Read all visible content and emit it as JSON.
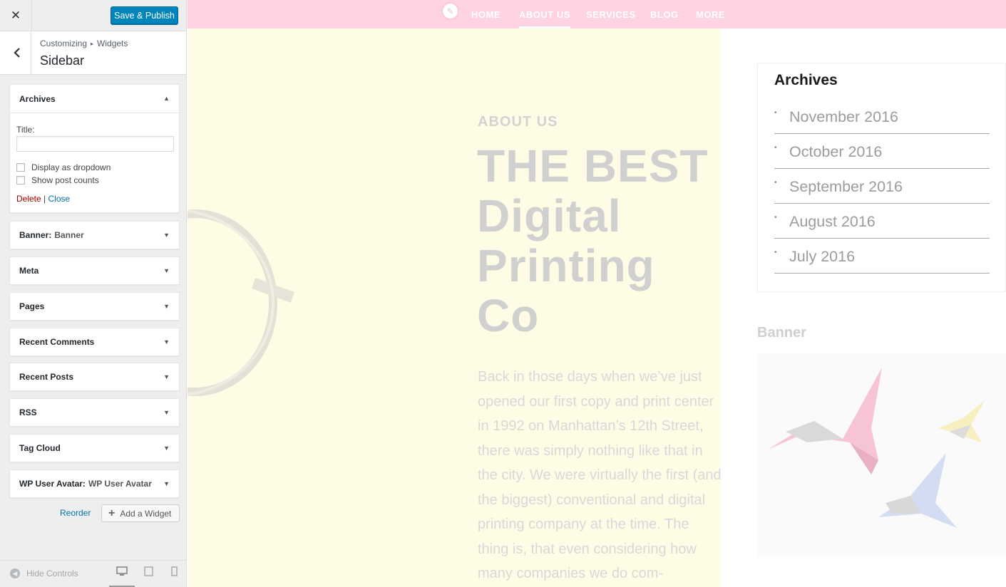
{
  "topbar": {
    "close_glyph": "✕",
    "save_label": "Save & Publish"
  },
  "section": {
    "breadcrumb_root": "Customizing",
    "breadcrumb_sep": "▸",
    "breadcrumb_leaf": "Widgets",
    "title": "Sidebar"
  },
  "open_widget": {
    "title": "Archives",
    "title_label": "Title:",
    "title_value": "",
    "option1": "Display as dropdown",
    "option2": "Show post counts",
    "delete_label": "Delete",
    "separator": "|",
    "close_label": "Close"
  },
  "widgets": [
    {
      "name": "Banner:",
      "sub": "Banner"
    },
    {
      "name": "Meta",
      "sub": ""
    },
    {
      "name": "Pages",
      "sub": ""
    },
    {
      "name": "Recent Comments",
      "sub": ""
    },
    {
      "name": "Recent Posts",
      "sub": ""
    },
    {
      "name": "RSS",
      "sub": ""
    },
    {
      "name": "Tag Cloud",
      "sub": ""
    },
    {
      "name": "WP User Avatar:",
      "sub": "WP User Avatar"
    }
  ],
  "actions": {
    "reorder_label": "Reorder",
    "add_widget_label": "Add a Widget",
    "add_glyph": "+"
  },
  "footer": {
    "hide_controls_label": "Hide Controls"
  },
  "preview": {
    "nav": [
      "HOME",
      "ABOUT US",
      "SERVICES",
      "BLOG",
      "MORE"
    ],
    "nav_active": "ABOUT US",
    "kicker": "ABOUT US",
    "hero_lines": [
      "THE BEST",
      "Digital",
      "Printing",
      "Co"
    ],
    "paragraph": "Back in those days when we’ve just opened our first copy and print center in 1992 on Manhattan’s 12th Street, there was simply nothing like that in the city. We were virtually the first (and the biggest) conventional and digital printing company at the time. The thing is, that even considering how many companies we do com-",
    "archives_title": "Archives",
    "archives": [
      "November 2016",
      "October 2016",
      "September 2016",
      "August 2016",
      "July 2016"
    ],
    "banner_title": "Banner"
  },
  "colors": {
    "primary_button": "#0085ba",
    "nav_bg": "#ffd3e0",
    "hero_bg": "#fffce6",
    "delete_link": "#aa0000",
    "link": "#0073aa"
  }
}
